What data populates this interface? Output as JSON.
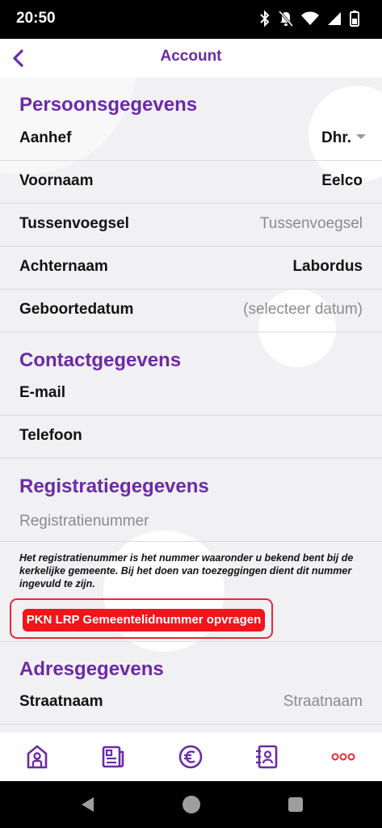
{
  "status": {
    "time": "20:50"
  },
  "header": {
    "title": "Account"
  },
  "sections": {
    "personal": "Persoonsgegevens",
    "contact": "Contactgegevens",
    "registration": "Registratiegegevens",
    "address": "Adresgegevens"
  },
  "fields": {
    "aanhef": {
      "label": "Aanhef",
      "value": "Dhr."
    },
    "voornaam": {
      "label": "Voornaam",
      "value": "Eelco"
    },
    "tussenvoegsel": {
      "label": "Tussenvoegsel",
      "placeholder": "Tussenvoegsel"
    },
    "achternaam": {
      "label": "Achternaam",
      "value": "Labordus"
    },
    "geboortedatum": {
      "label": "Geboortedatum",
      "placeholder": "(selecteer datum)"
    },
    "email": {
      "label": "E-mail",
      "value": ""
    },
    "telefoon": {
      "label": "Telefoon",
      "value": ""
    },
    "registratienummer": {
      "placeholder": "Registratienummer"
    },
    "straatnaam": {
      "label": "Straatnaam",
      "placeholder": "Straatnaam"
    }
  },
  "registration_note": "Het registratienummer is het nummer waaronder u bekend bent bij de kerkelijke gemeente. Bij het doen van toezeggingen dient dit nummer ingevuld te zijn.",
  "pkn_button_label": "PKN LRP Gemeentelidnummer opvragen",
  "colors": {
    "accent": "#6b2aa8",
    "danger": "#f2141a",
    "more": "#e8283a"
  },
  "bottom_nav": [
    "home-icon",
    "news-icon",
    "euro-icon",
    "contacts-icon",
    "more-icon"
  ]
}
